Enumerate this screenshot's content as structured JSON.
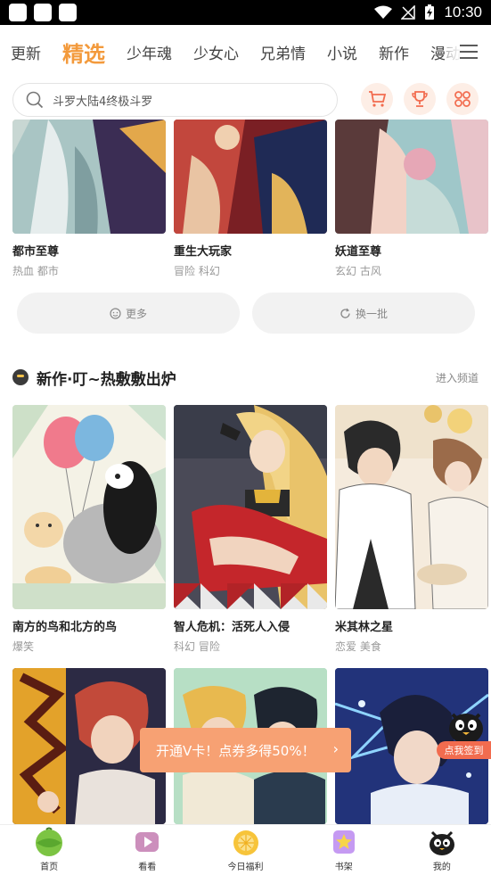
{
  "status_bar": {
    "time": "10:30"
  },
  "tabs": [
    "更新",
    "精选",
    "少年魂",
    "少女心",
    "兄弟情",
    "小说",
    "新作",
    "漫动"
  ],
  "active_tab": 1,
  "search": {
    "placeholder": "斗罗大陆4终极斗罗"
  },
  "top_row": [
    {
      "title": "都市至尊",
      "tags": "热血 都市"
    },
    {
      "title": "重生大玩家",
      "tags": "冒险 科幻"
    },
    {
      "title": "妖道至尊",
      "tags": "玄幻 古风"
    }
  ],
  "actions": {
    "more": "更多",
    "refresh": "换一批"
  },
  "section": {
    "title": "新作·叮~热敷敷出炉",
    "more": "进入频道"
  },
  "new_row": [
    {
      "title": "南方的鸟和北方的鸟",
      "tags": "爆笑"
    },
    {
      "title": "智人危机：活死人入侵",
      "tags": "科幻 冒险"
    },
    {
      "title": "米其林之星",
      "tags": "恋爱 美食"
    }
  ],
  "promo": {
    "text": "开通V卡！点券多得50%！",
    "arrow": "›"
  },
  "sign_in": {
    "label": "点我签到"
  },
  "bottom_nav": [
    {
      "label": "首页",
      "icon": "home-melon-icon"
    },
    {
      "label": "看看",
      "icon": "video-play-icon"
    },
    {
      "label": "今日福利",
      "icon": "lemon-gift-icon"
    },
    {
      "label": "书架",
      "icon": "star-shelf-icon"
    },
    {
      "label": "我的",
      "icon": "penguin-profile-icon"
    }
  ],
  "colors": {
    "accent": "#f39a3c",
    "promo": "#f7a173",
    "sign": "#f26c4f",
    "search_btn_bg": "#fdeee6",
    "icon_red": "#f26c4f"
  }
}
